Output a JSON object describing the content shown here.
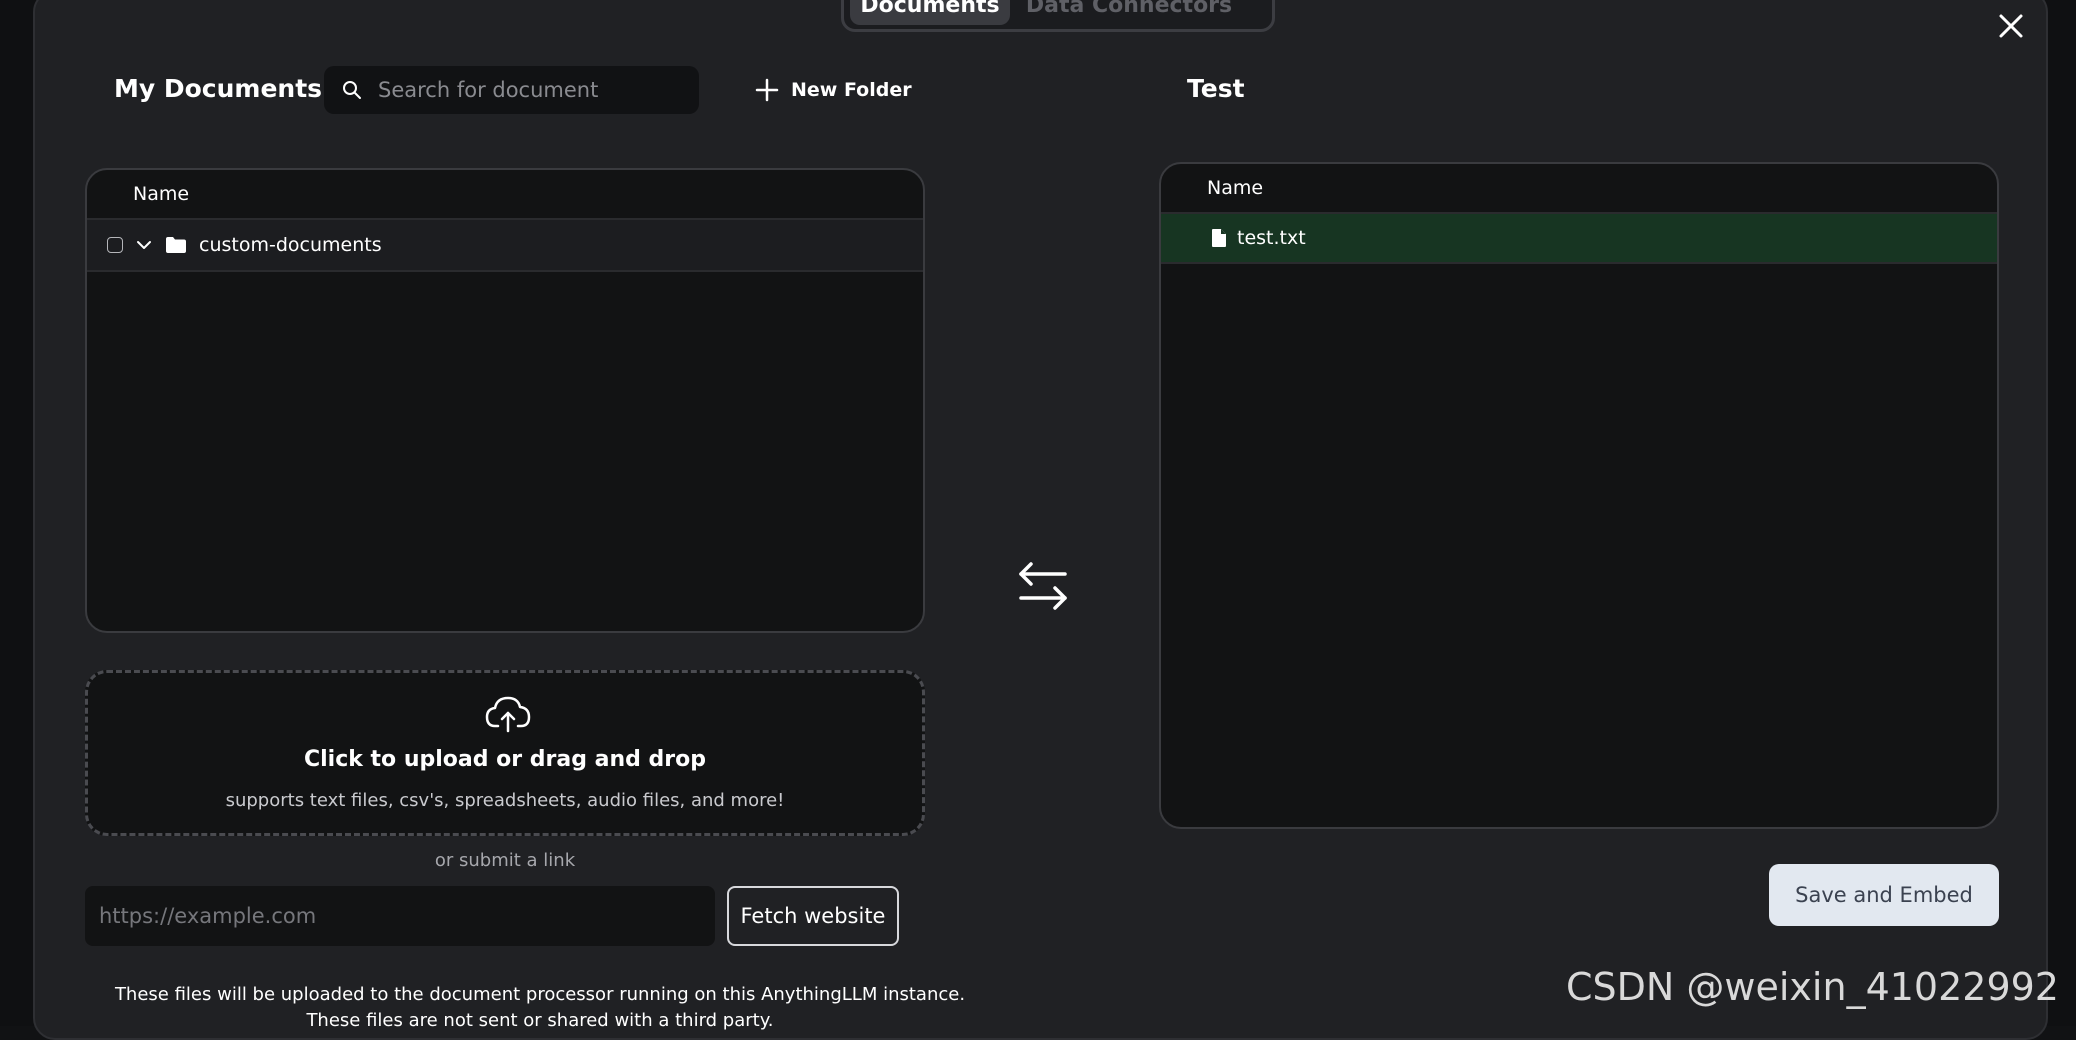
{
  "tabs": {
    "documents": "Documents",
    "data_connectors": "Data Connectors"
  },
  "left": {
    "title": "My Documents",
    "search_placeholder": "Search for document",
    "new_folder": "New Folder",
    "column_name": "Name",
    "folder": "custom-documents",
    "upload_title": "Click to upload or drag and drop",
    "upload_sub": "supports text files, csv's, spreadsheets, audio files, and more!",
    "or_link": "or submit a link",
    "url_placeholder": "https://example.com",
    "fetch_label": "Fetch website",
    "note_line1": "These files will be uploaded to the document processor running on this AnythingLLM instance.",
    "note_line2": "These files are not sent or shared with a third party."
  },
  "right": {
    "title": "Test",
    "column_name": "Name",
    "file": "test.txt",
    "save_label": "Save and Embed"
  },
  "watermark": "CSDN @weixin_41022992",
  "colors": {
    "selected_row": "#173522",
    "save_button": "#e2e8f0",
    "modal_bg": "#202124"
  }
}
